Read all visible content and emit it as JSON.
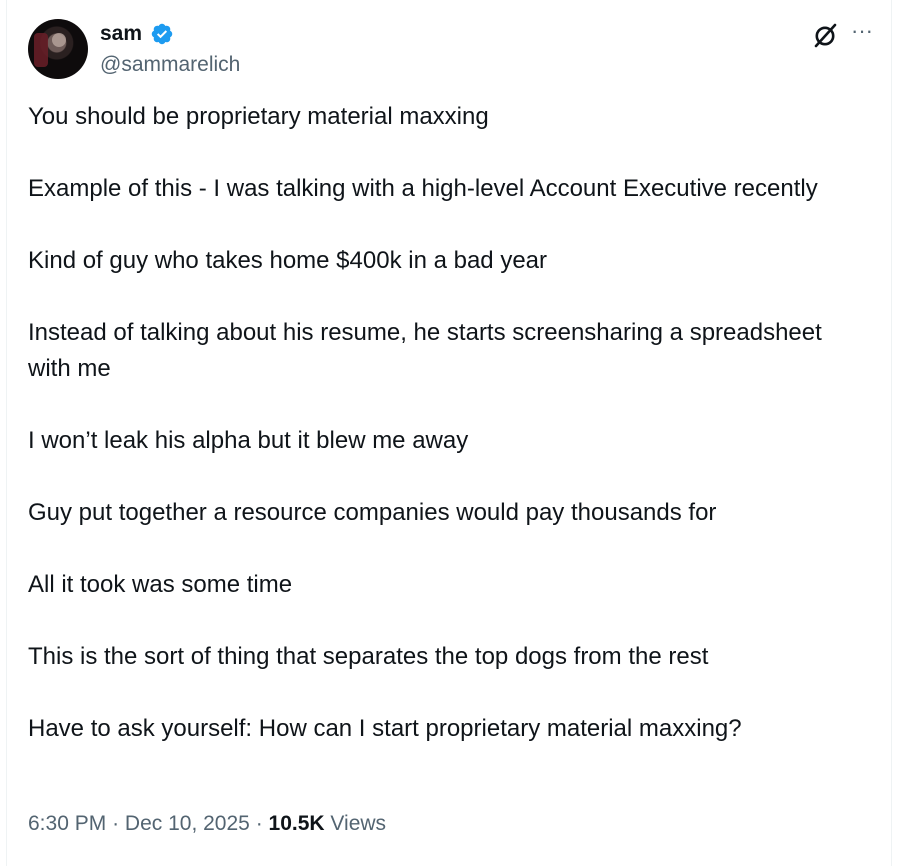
{
  "author": {
    "name": "sam",
    "handle": "@sammarelich",
    "verified_icon": "verified-badge-icon",
    "avatar_icon": "profile-photo"
  },
  "header_actions": {
    "grok_icon": "grok-slash-icon",
    "more_icon": "more-horizontal-icon",
    "more_label": "···"
  },
  "tweet": {
    "paragraphs": [
      "You should be proprietary material maxxing",
      "Example of this - I was talking with a high-level Account Executive recently",
      "Kind of guy who takes home $400k in a bad year",
      "Instead of talking about his resume, he starts screensharing a spreadsheet with me",
      "I won’t leak his alpha but it blew me away",
      "Guy put together a resource companies would pay thousands for",
      "All it took was some time",
      "This is the sort of thing that separates the top dogs from the rest",
      "Have to ask yourself: How can I start proprietary material maxxing?"
    ]
  },
  "meta": {
    "time": "6:30 PM",
    "separator": "·",
    "date": "Dec 10, 2025",
    "views_count": "10.5K",
    "views_label": "Views"
  },
  "colors": {
    "text": "#0f1419",
    "secondary": "#536471",
    "verified": "#1d9bf0"
  }
}
